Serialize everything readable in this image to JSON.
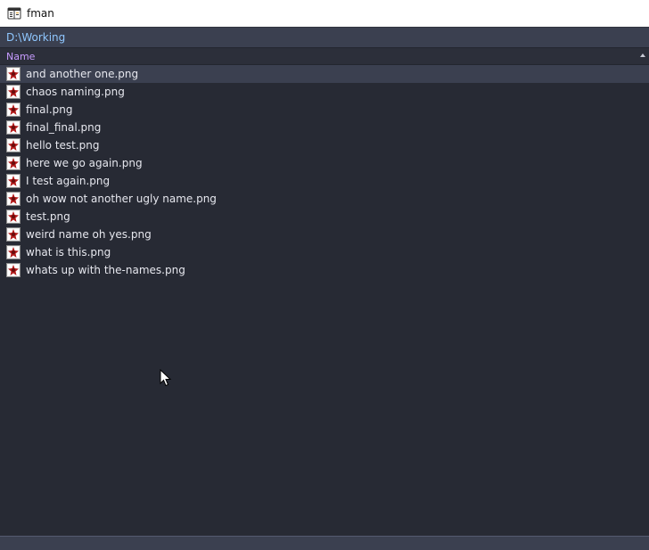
{
  "window": {
    "title": "fman",
    "app_icon": "fman-app-icon"
  },
  "pathbar": {
    "path": "D:\\Working"
  },
  "columns": [
    {
      "label": "Name",
      "sorted": "ascending"
    }
  ],
  "files": [
    {
      "name": "and another one.png",
      "selected": true
    },
    {
      "name": "chaos naming.png",
      "selected": false
    },
    {
      "name": "final.png",
      "selected": false
    },
    {
      "name": "final_final.png",
      "selected": false
    },
    {
      "name": "hello test.png",
      "selected": false
    },
    {
      "name": "here we go again.png",
      "selected": false
    },
    {
      "name": "I test again.png",
      "selected": false
    },
    {
      "name": "oh wow not another ugly name.png",
      "selected": false
    },
    {
      "name": "test.png",
      "selected": false
    },
    {
      "name": "weird name oh yes.png",
      "selected": false
    },
    {
      "name": "what is this.png",
      "selected": false
    },
    {
      "name": "whats up with the-names.png",
      "selected": false
    }
  ],
  "colors": {
    "background": "#272a34",
    "selection": "#3b4050",
    "path_text": "#8fc7ff",
    "header_text": "#c79cff",
    "file_text": "#e6e7ee"
  },
  "icons": {
    "file_icon": "png-image-file-icon"
  }
}
